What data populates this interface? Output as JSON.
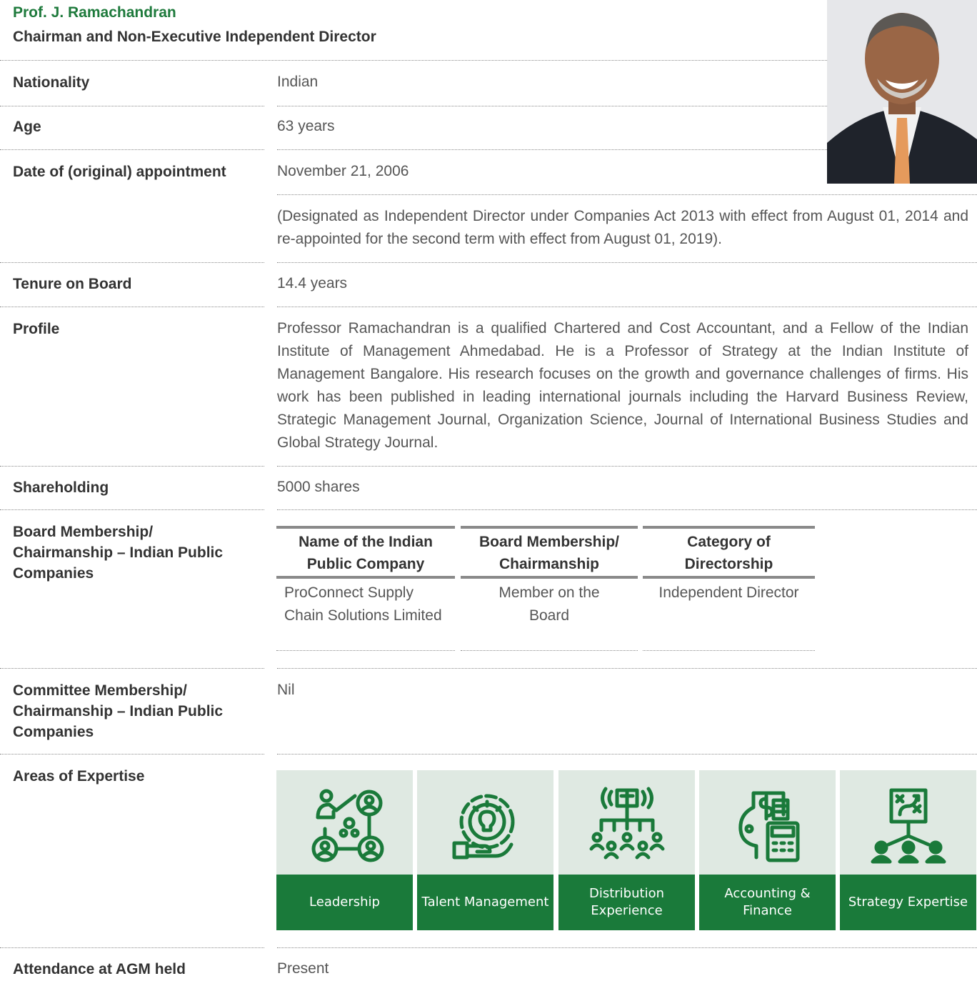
{
  "person": {
    "name": "Prof. J. Ramachandran",
    "designation": "Chairman and Non-Executive Independent Director"
  },
  "rows": {
    "nationality": {
      "label": "Nationality",
      "value": "Indian"
    },
    "age": {
      "label": "Age",
      "value": "63 years"
    },
    "appointment": {
      "label": "Date of (original) appointment",
      "value": "November 21, 2006",
      "note": "(Designated as Independent Director under Companies Act 2013 with effect from August 01, 2014 and re-appointed for the second term with effect from August 01, 2019)."
    },
    "tenure": {
      "label": "Tenure on Board",
      "value": "14.4 years"
    },
    "profile": {
      "label": "Profile",
      "value": "Professor Ramachandran is a qualified Chartered and Cost Accountant, and a Fellow of the Indian Institute of Management Ahmedabad. He is a Professor of Strategy at the Indian Institute of Management Bangalore. His research focuses on the growth and governance challenges of firms. His work has been published in leading international journals including the Harvard Business Review, Strategic Management Journal, Organization Science, Journal of International Business Studies and Global Strategy Journal."
    },
    "shareholding": {
      "label": "Shareholding",
      "value": "5000 shares"
    },
    "board": {
      "label": "Board Membership/ Chairmanship – Indian Public Companies",
      "headers": [
        "Name of the Indian Public Company",
        "Board Membership/ Chairmanship",
        "Category of Directorship"
      ],
      "row": [
        "ProConnect Supply Chain Solutions Limited",
        "Member on the Board",
        "Independent Director"
      ]
    },
    "committee": {
      "label": "Committee Membership/ Chairmanship – Indian Public Companies",
      "value": "Nil"
    },
    "expertise": {
      "label": "Areas of Expertise",
      "cards": [
        {
          "label": "Leadership",
          "icon": "leadership-icon"
        },
        {
          "label": "Talent Management",
          "icon": "talent-management-icon"
        },
        {
          "label": "Distribution Experience",
          "icon": "distribution-icon"
        },
        {
          "label": "Accounting & Finance",
          "icon": "accounting-finance-icon"
        },
        {
          "label": "Strategy Expertise",
          "icon": "strategy-icon"
        }
      ]
    },
    "attendance": {
      "label": "Attendance at AGM held",
      "value": "Present"
    }
  },
  "colors": {
    "accent_green": "#1a7a3a",
    "card_bg": "#dfe9e2",
    "name_green": "#1e7a3c"
  }
}
